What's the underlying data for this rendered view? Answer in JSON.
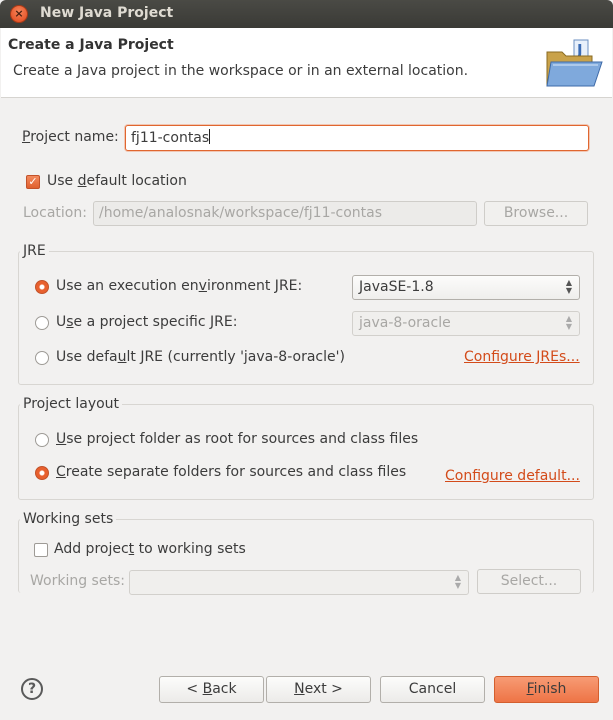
{
  "window": {
    "title": "New Java Project",
    "close_glyph": "×"
  },
  "header": {
    "title": "Create a Java Project",
    "description": "Create a Java project in the workspace or in an external location.",
    "icon": "java-project-folder-icon"
  },
  "project_name": {
    "label_pre": "",
    "label_mnemonic": "P",
    "label_post": "roject name:",
    "value": "fj11-contas"
  },
  "default_location": {
    "checked": true,
    "label_pre": "Use ",
    "label_mnemonic": "d",
    "label_post": "efault location"
  },
  "location": {
    "label": "Location:",
    "value": "/home/analosnak/workspace/fj11-contas",
    "browse_label": "Browse..."
  },
  "jre": {
    "title": "JRE",
    "option1_pre": "Use an execution en",
    "option1_mnemonic": "v",
    "option1_post": "ironment JRE:",
    "option1_value": "JavaSE-1.8",
    "option2_pre": "U",
    "option2_mnemonic": "s",
    "option2_post": "e a project specific JRE:",
    "option2_value": "java-8-oracle",
    "option3_pre": "Use defa",
    "option3_mnemonic": "u",
    "option3_post": "lt JRE (currently 'java-8-oracle')",
    "configure_link": "Configure JREs..."
  },
  "layout": {
    "title": "Project layout",
    "option1_pre": "",
    "option1_mnemonic": "U",
    "option1_post": "se project folder as root for sources and class files",
    "option2_pre": "",
    "option2_mnemonic": "C",
    "option2_post": "reate separate folders for sources and class files",
    "configure_link": "Configure default..."
  },
  "working_sets": {
    "title": "Working sets",
    "add_pre": "Add projec",
    "add_mnemonic": "t",
    "add_post": " to working sets",
    "label": "Working sets:",
    "select_label": "Select..."
  },
  "footer": {
    "help_glyph": "?",
    "back_pre": "< ",
    "back_mnemonic": "B",
    "back_post": "ack",
    "next_pre": "",
    "next_mnemonic": "N",
    "next_post": "ext >",
    "cancel": "Cancel",
    "finish_pre": "",
    "finish_mnemonic": "F",
    "finish_post": "inish"
  },
  "colors": {
    "accent": "#e8602e",
    "link": "#d34b1a",
    "titlebar": "#3c3b37"
  }
}
